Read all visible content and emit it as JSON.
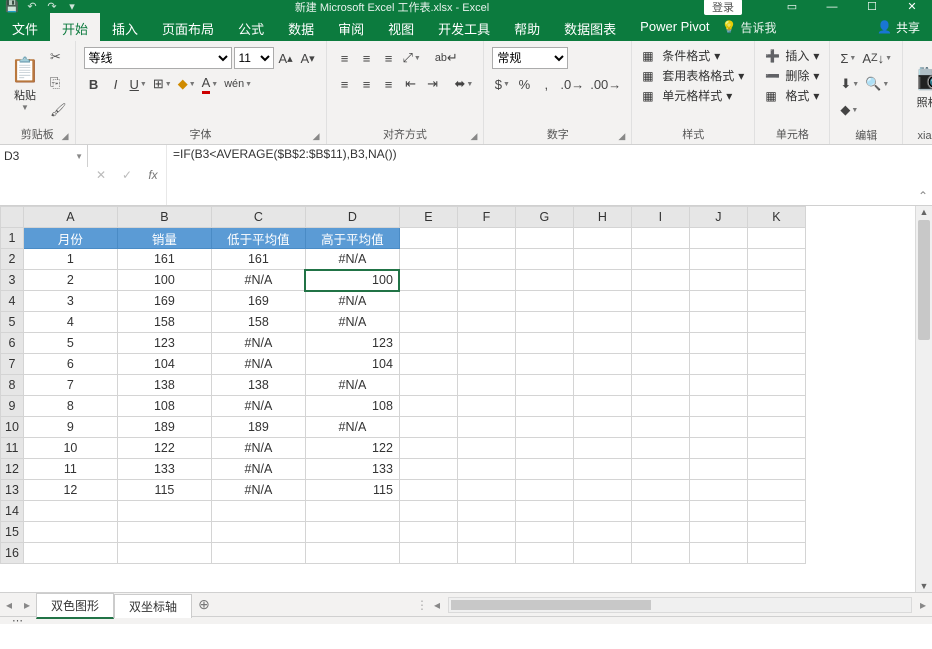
{
  "title": "新建 Microsoft Excel 工作表.xlsx - Excel",
  "login": "登录",
  "menus": {
    "file": "文件",
    "home": "开始",
    "insert": "插入",
    "layout": "页面布局",
    "formulas": "公式",
    "data": "数据",
    "review": "审阅",
    "view": "视图",
    "dev": "开发工具",
    "help": "帮助",
    "charts": "数据图表",
    "power": "Power Pivot",
    "tellme": "告诉我",
    "share": "共享"
  },
  "ribbon": {
    "clipboard": {
      "paste": "粘贴",
      "label": "剪贴板"
    },
    "font": {
      "name": "等线",
      "size": "11",
      "label": "字体"
    },
    "align": {
      "label": "对齐方式",
      "wrap": "ab"
    },
    "number": {
      "format": "常规",
      "label": "数字"
    },
    "styles": {
      "cond": "条件格式",
      "table": "套用表格格式",
      "cell": "单元格样式",
      "label": "样式"
    },
    "cells": {
      "insert": "插入",
      "delete": "删除",
      "format": "格式",
      "label": "单元格"
    },
    "editing": {
      "label": "编辑"
    },
    "camera": {
      "label": "照相机",
      "group": "xiangji"
    }
  },
  "namebox": "D3",
  "formula": "=IF(B3<AVERAGE($B$2:$B$11),B3,NA())",
  "cols": [
    "A",
    "B",
    "C",
    "D",
    "E",
    "F",
    "G",
    "H",
    "I",
    "J",
    "K"
  ],
  "rowhdrs": [
    "1",
    "2",
    "3",
    "4",
    "5",
    "6",
    "7",
    "8",
    "9",
    "10",
    "11",
    "12",
    "13",
    "14",
    "15",
    "16"
  ],
  "headers": {
    "a": "月份",
    "b": "销量",
    "c": "低于平均值",
    "d": "高于平均值"
  },
  "rows": [
    {
      "m": "1",
      "s": "161",
      "low": "161",
      "high": "#N/A",
      "hr": false
    },
    {
      "m": "2",
      "s": "100",
      "low": "#N/A",
      "high": "100",
      "hr": true
    },
    {
      "m": "3",
      "s": "169",
      "low": "169",
      "high": "#N/A",
      "hr": false
    },
    {
      "m": "4",
      "s": "158",
      "low": "158",
      "high": "#N/A",
      "hr": false
    },
    {
      "m": "5",
      "s": "123",
      "low": "#N/A",
      "high": "123",
      "hr": true
    },
    {
      "m": "6",
      "s": "104",
      "low": "#N/A",
      "high": "104",
      "hr": true
    },
    {
      "m": "7",
      "s": "138",
      "low": "138",
      "high": "#N/A",
      "hr": false
    },
    {
      "m": "8",
      "s": "108",
      "low": "#N/A",
      "high": "108",
      "hr": true
    },
    {
      "m": "9",
      "s": "189",
      "low": "189",
      "high": "#N/A",
      "hr": false
    },
    {
      "m": "10",
      "s": "122",
      "low": "#N/A",
      "high": "122",
      "hr": true
    },
    {
      "m": "11",
      "s": "133",
      "low": "#N/A",
      "high": "133",
      "hr": true
    },
    {
      "m": "12",
      "s": "115",
      "low": "#N/A",
      "high": "115",
      "hr": true
    }
  ],
  "sheets": {
    "s1": "双色图形",
    "s2": "双坐标轴"
  }
}
